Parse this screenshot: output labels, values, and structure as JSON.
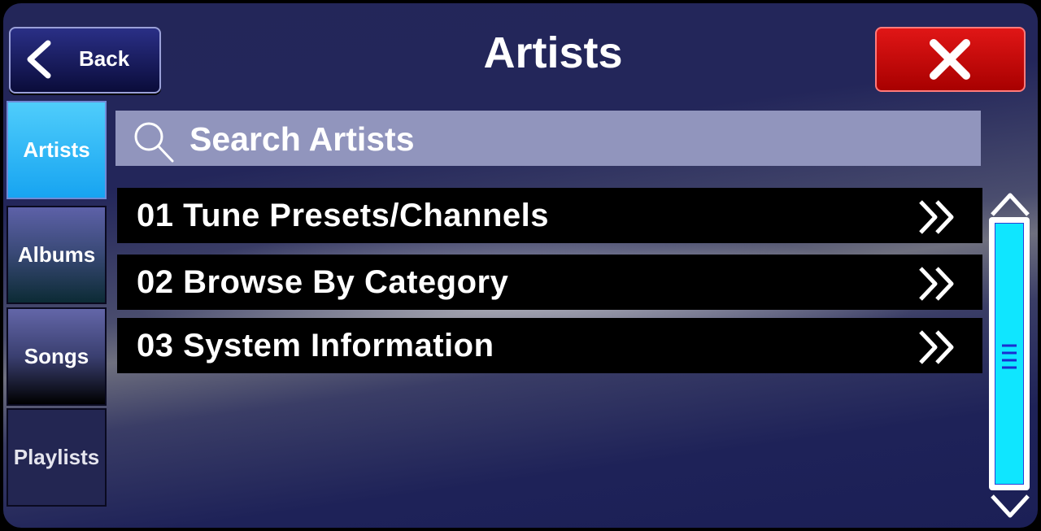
{
  "header": {
    "back_label": "Back",
    "title": "Artists",
    "back_icon": "chevron-left-icon",
    "close_icon": "close-x-icon"
  },
  "tabs": [
    {
      "label": "Artists",
      "active": true
    },
    {
      "label": "Albums",
      "active": false
    },
    {
      "label": "Songs",
      "active": false
    },
    {
      "label": "Playlists",
      "active": false
    }
  ],
  "search": {
    "placeholder": "Search Artists",
    "icon": "search-icon"
  },
  "list": {
    "items": [
      {
        "label": "01 Tune Presets/Channels",
        "icon": "double-chevron-right-icon"
      },
      {
        "label": "02 Browse By Category",
        "icon": "double-chevron-right-icon"
      },
      {
        "label": "03 System Information",
        "icon": "double-chevron-right-icon"
      }
    ]
  },
  "colors": {
    "accent_active_tab": "#17a4f1",
    "close_button": "#c80000",
    "scroll_fill": "#0fe6ff",
    "background": "#23265a"
  }
}
